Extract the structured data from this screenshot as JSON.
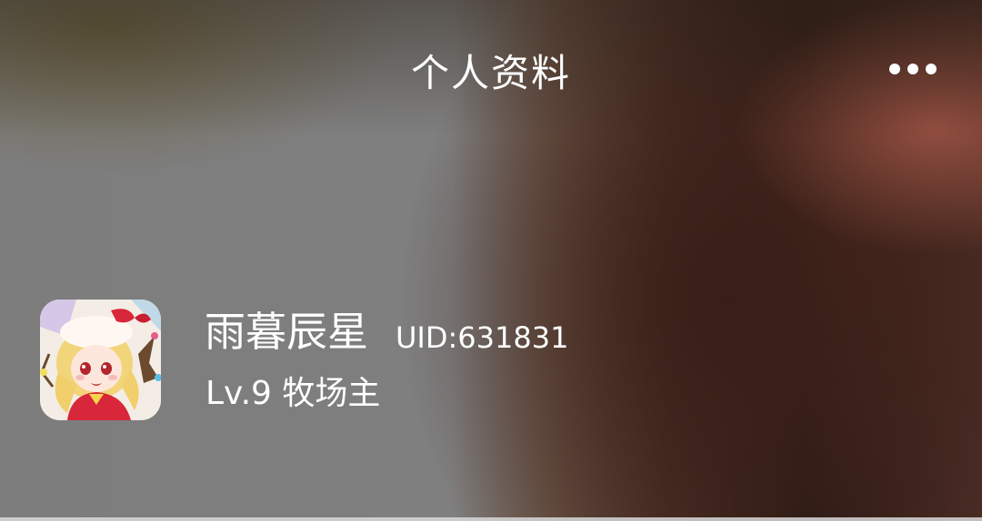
{
  "header": {
    "title": "个人资料",
    "more_icon": "more-horizontal-icon"
  },
  "profile": {
    "avatar": "anime-character-avatar",
    "name": "雨暮辰星",
    "uid": "UID:631831",
    "level": "Lv.9 牧场主"
  },
  "colors": {
    "text": "#ffffff",
    "background_left": "#7f7f7f",
    "background_right": "#2e1c16"
  }
}
